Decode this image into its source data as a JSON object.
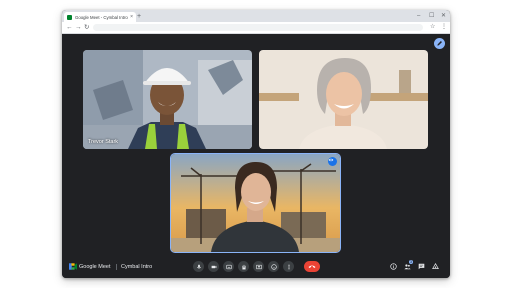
{
  "browser": {
    "tab_title": "Google Meet - Cymbal Intro",
    "tab_close": "×",
    "new_tab": "+",
    "window_controls": {
      "minimize": "–",
      "maximize": "☐",
      "close": "✕"
    },
    "nav": {
      "back": "←",
      "forward": "→",
      "reload": "↻"
    },
    "toolbar_icons": {
      "star": "☆",
      "menu": "⋮"
    }
  },
  "meeting": {
    "product_name": "Google Meet",
    "title": "Cymbal Intro",
    "participants": [
      {
        "name": "Trevor Stark"
      },
      {
        "name": ""
      },
      {
        "name": ""
      }
    ],
    "people_count": "3",
    "controls": [
      "mic-icon",
      "camera-icon",
      "captions-icon",
      "raise-hand-icon",
      "present-icon",
      "emoji-icon",
      "more-options-icon",
      "end-call-icon"
    ],
    "right_controls": [
      "info-icon",
      "people-icon",
      "chat-icon",
      "activities-icon"
    ]
  },
  "colors": {
    "background": "#202124",
    "control": "#3c4043",
    "end_call": "#ea4335",
    "accent": "#8ab4f8",
    "badge": "#1a73e8"
  }
}
